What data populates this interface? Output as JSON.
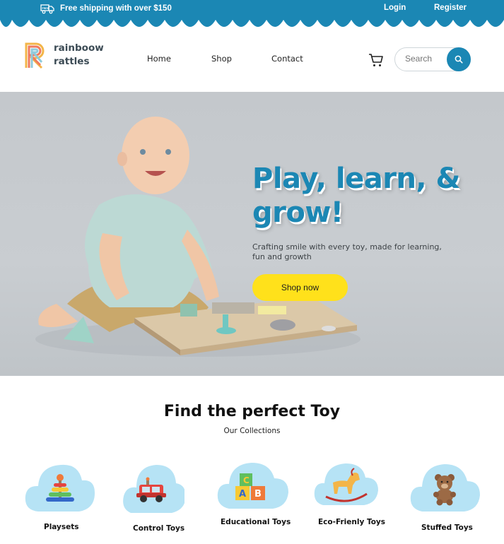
{
  "topbar": {
    "shipping_text": "Free shipping with over $150",
    "login_label": "Login",
    "register_label": "Register",
    "truck_icon": "truck-icon",
    "bg_color": "#1b87b4"
  },
  "header": {
    "logo_line1": "rainboow",
    "logo_line2": "rattles",
    "nav": [
      "Home",
      "Shop",
      "Contact"
    ],
    "cart_icon": "cart-icon",
    "search": {
      "placeholder": "Search",
      "icon": "search-icon"
    }
  },
  "hero": {
    "title": "Play, learn, & grow!",
    "subtitle": "Crafting smile with every toy, made for learning, fun and growth",
    "cta_label": "Shop now",
    "accent": "#1b87b4",
    "cta_color": "#ffe11b"
  },
  "collections": {
    "title": "Find the perfect Toy",
    "subtitle": "Our Collections",
    "cloud_color": "#b6e3f5",
    "items": [
      {
        "label": "Playsets",
        "icon": "stacking-rings-icon"
      },
      {
        "label": "Control Toys",
        "icon": "toy-car-icon"
      },
      {
        "label": "Educational Toys",
        "icon": "abc-blocks-icon"
      },
      {
        "label": "Eco-Frienly Toys",
        "icon": "rocking-horse-icon"
      },
      {
        "label": "Stuffed Toys",
        "icon": "teddy-bear-icon"
      }
    ]
  }
}
